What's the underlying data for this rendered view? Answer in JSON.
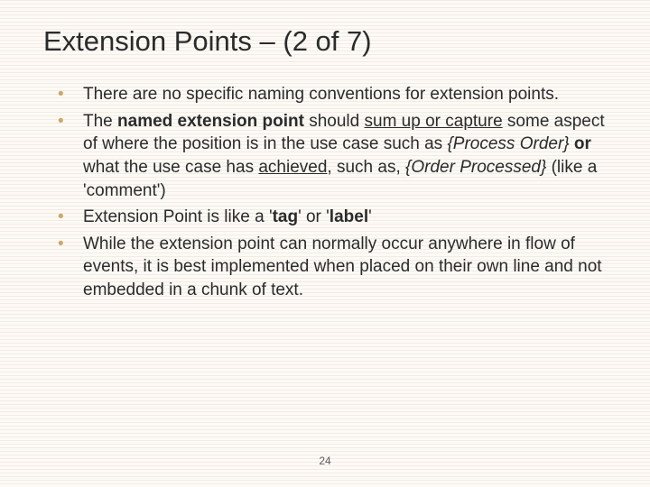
{
  "title": "Extension Points – (2 of 7)",
  "bullets": [
    {
      "pre": "There are no specific naming conventions for extension points."
    },
    {
      "t1": "The ",
      "b1": "named extension point",
      "t2": " should ",
      "u1": "sum up or capture",
      "t3": " some aspect of where the position is in the use case such as ",
      "i1": "{Process Order}",
      "t4": " ",
      "b2": "or",
      "t5": " what the use case has ",
      "u2": "achieved",
      "t6": ", such as,   ",
      "i2": "{Order Processed}",
      "t7": " (like a 'comment')"
    },
    {
      "t1": "Extension Point is like a '",
      "b1": "tag",
      "t2": "' or '",
      "b2": "label",
      "t3": "'"
    },
    {
      "pre": "While the extension point can normally occur anywhere in flow of events, it is best implemented when placed on their own line and not embedded in a chunk of text."
    }
  ],
  "page_number": "24"
}
